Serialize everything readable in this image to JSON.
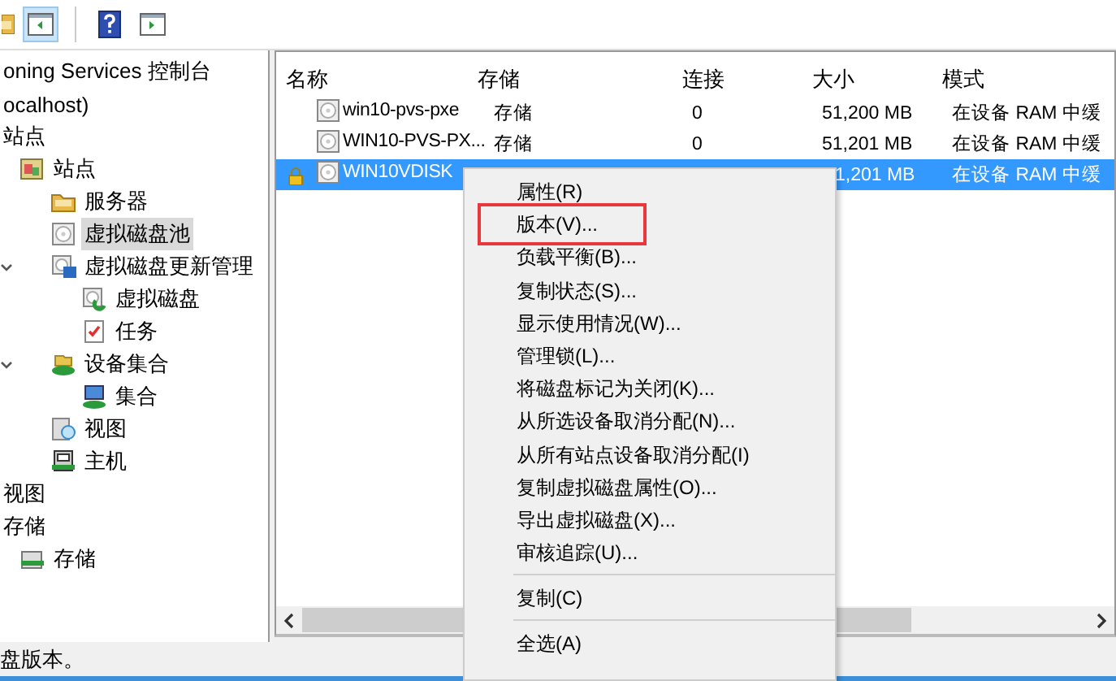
{
  "toolbar": {
    "buttons": [
      {
        "kind": "folder",
        "selected": false
      },
      {
        "kind": "pane",
        "selected": true
      },
      {
        "kind": "separator"
      },
      {
        "kind": "help",
        "selected": false
      },
      {
        "kind": "pane-alt",
        "selected": false
      }
    ]
  },
  "tree": {
    "items": [
      {
        "label": "oning Services 控制台",
        "children": [
          {
            "label": "ocalhost)",
            "children": [
              {
                "label": "站点",
                "children": [
                  {
                    "label": "站点",
                    "kind": "site",
                    "children": [
                      {
                        "label": "服务器",
                        "kind": "folder"
                      },
                      {
                        "label": "虚拟磁盘池",
                        "kind": "disk",
                        "selected": true
                      },
                      {
                        "label": "虚拟磁盘更新管理",
                        "kind": "update",
                        "expanded": true,
                        "children": [
                          {
                            "label": "虚拟磁盘",
                            "kind": "disk-green"
                          },
                          {
                            "label": "任务",
                            "kind": "task"
                          }
                        ]
                      },
                      {
                        "label": "设备集合",
                        "kind": "collection",
                        "expanded": true,
                        "children": [
                          {
                            "label": "集合",
                            "kind": "pc"
                          }
                        ]
                      },
                      {
                        "label": "视图",
                        "kind": "view"
                      },
                      {
                        "label": "主机",
                        "kind": "host"
                      }
                    ]
                  }
                ]
              },
              {
                "label": "视图"
              },
              {
                "label": "存储",
                "children": [
                  {
                    "label": "存储",
                    "kind": "storage"
                  }
                ]
              }
            ]
          }
        ]
      }
    ]
  },
  "table": {
    "columns": [
      "名称",
      "存储",
      "连接",
      "大小",
      "模式"
    ],
    "rows": [
      {
        "name": "win10-pvs-pxe",
        "storage": "存储",
        "connections": "0",
        "size": "51,200 MB",
        "mode": "在设备 RAM 中缓",
        "selected": false,
        "locked": false
      },
      {
        "name": "WIN10-PVS-PX...",
        "storage": "存储",
        "connections": "0",
        "size": "51,201 MB",
        "mode": "在设备 RAM 中缓",
        "selected": false,
        "locked": false
      },
      {
        "name": "WIN10VDISK",
        "size": "1,201 MB",
        "mode": "在设备 RAM 中缓",
        "selected": true,
        "locked": true
      }
    ]
  },
  "context_menu": {
    "items": [
      {
        "kind": "item",
        "label": "属性(R)",
        "highlighted": false
      },
      {
        "kind": "item",
        "label": "版本(V)...",
        "highlighted": true
      },
      {
        "kind": "item",
        "label": "负载平衡(B)...",
        "highlighted": false
      },
      {
        "kind": "item",
        "label": "复制状态(S)...",
        "highlighted": false
      },
      {
        "kind": "item",
        "label": "显示使用情况(W)...",
        "highlighted": false
      },
      {
        "kind": "item",
        "label": "管理锁(L)...",
        "highlighted": false
      },
      {
        "kind": "item",
        "label": "将磁盘标记为关闭(K)...",
        "highlighted": false
      },
      {
        "kind": "item",
        "label": "从所选设备取消分配(N)...",
        "highlighted": false
      },
      {
        "kind": "item",
        "label": "从所有站点设备取消分配(I)",
        "highlighted": false
      },
      {
        "kind": "item",
        "label": "复制虚拟磁盘属性(O)...",
        "highlighted": false
      },
      {
        "kind": "item",
        "label": "导出虚拟磁盘(X)...",
        "highlighted": false
      },
      {
        "kind": "item",
        "label": "审核追踪(U)...",
        "highlighted": false
      },
      {
        "kind": "separator"
      },
      {
        "kind": "item",
        "label": "复制(C)",
        "highlighted": false
      },
      {
        "kind": "separator"
      },
      {
        "kind": "item",
        "label": "全选(A)",
        "highlighted": false
      }
    ]
  },
  "status_bar": {
    "text": "盘版本。"
  }
}
